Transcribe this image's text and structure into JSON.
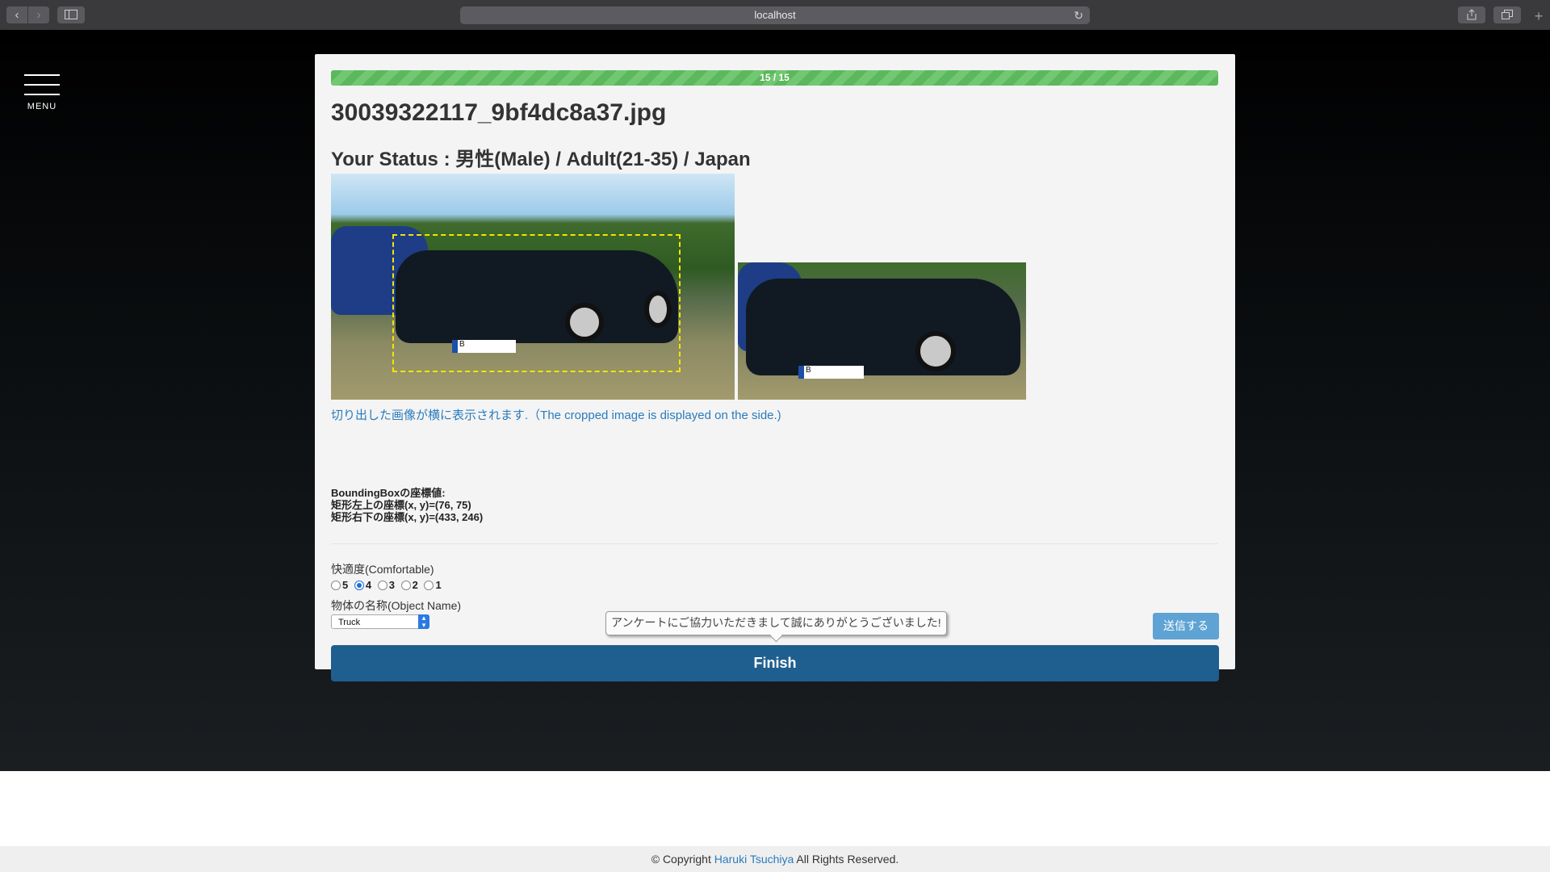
{
  "browser": {
    "url": "localhost",
    "back_icon": "‹",
    "forward_icon": "›",
    "reload_icon": "↻",
    "new_tab_icon": "+"
  },
  "menu": {
    "label": "MENU"
  },
  "progress": {
    "text": "15 / 15",
    "current": 15,
    "total": 15,
    "fraction": 1.0
  },
  "image": {
    "filename": "30039322117_9bf4dc8a37.jpg",
    "plate_text": "B"
  },
  "status": {
    "text": "Your Status : 男性(Male) / Adult(21-35) / Japan"
  },
  "crop_note": "切り出した画像が横に表示されます.（The cropped image is displayed on the side.)",
  "bbox_info": {
    "title": "BoundingBoxの座標値:",
    "top_left": "矩形左上の座標(x, y)=(76, 75)",
    "bottom_right": "矩形右下の座標(x, y)=(433, 246)"
  },
  "comfort": {
    "label": "快適度(Comfortable)",
    "options": [
      "5",
      "4",
      "3",
      "2",
      "1"
    ],
    "selected": "4"
  },
  "object_name": {
    "label": "物体の名称(Object Name)",
    "selected": "Truck"
  },
  "tooltip": "アンケートにご協力いただきまして誠にありがとうございました!",
  "buttons": {
    "submit": "送信する",
    "finish": "Finish"
  },
  "footer": {
    "prefix": "© Copyright ",
    "author": "Haruki Tsuchiya",
    "suffix": " All Rights Reserved."
  },
  "colors": {
    "progress": "#5cb85c",
    "finish": "#1f5f8f",
    "submit": "#5ea3d3",
    "link": "#2a7bbd"
  }
}
